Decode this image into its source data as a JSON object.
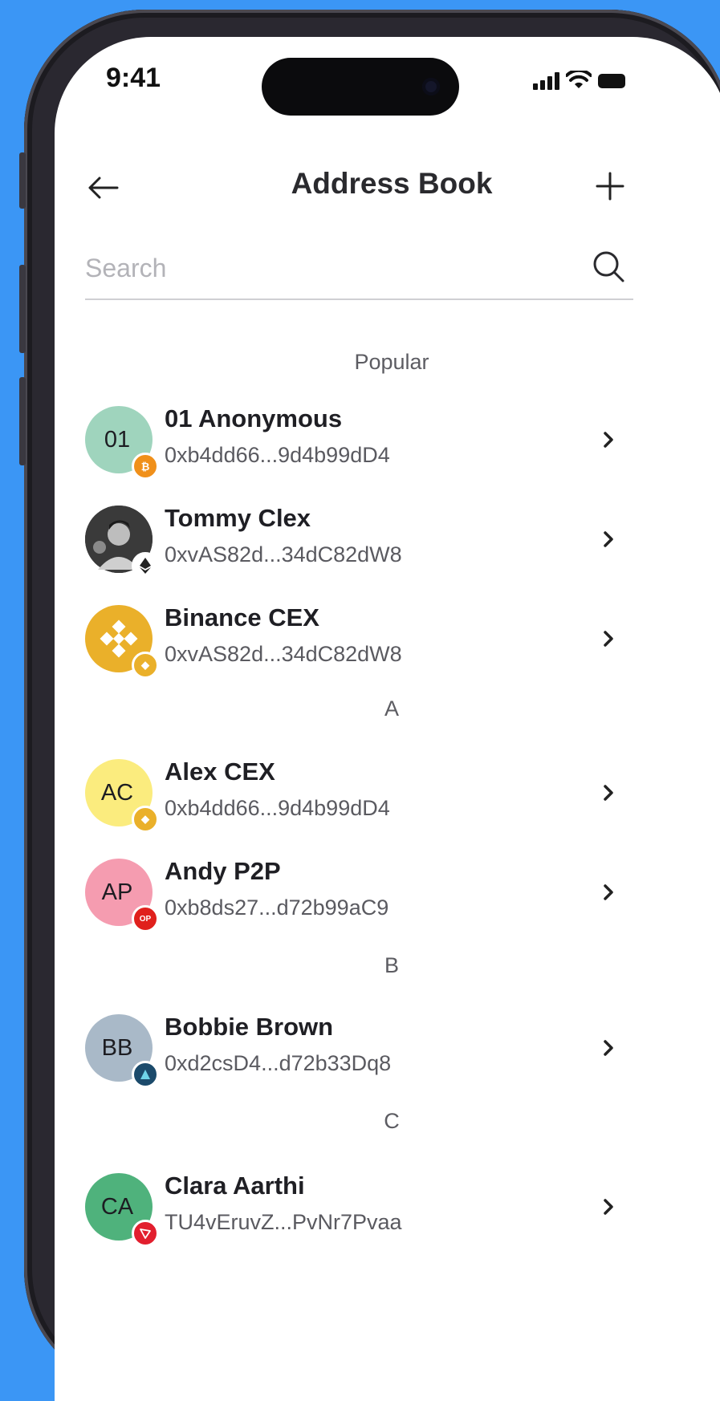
{
  "status_bar": {
    "time": "9:41"
  },
  "header": {
    "title": "Address Book"
  },
  "search": {
    "placeholder": "Search"
  },
  "sections": {
    "popular": "Popular",
    "a": "A",
    "b": "B",
    "c": "C"
  },
  "contacts": {
    "anonymous": {
      "initials": "01",
      "name": "01 Anonymous",
      "address": "0xb4dd66...9d4b99dD4",
      "avatar_color": "#9fd4bd",
      "network_icon": "bitcoin-icon",
      "network_color": "#f0901a"
    },
    "tommy": {
      "initials": "",
      "name": "Tommy Clex",
      "address": "0xvAS82d...34dC82dW8",
      "avatar_color": "#2b2b2b",
      "network_icon": "ethereum-icon",
      "network_color": "#ffffff"
    },
    "binance": {
      "initials": "",
      "name": "Binance CEX",
      "address": "0xvAS82d...34dC82dW8",
      "avatar_color": "#eab02a",
      "network_icon": "bnb-icon",
      "network_color": "#eab02a"
    },
    "alex": {
      "initials": "AC",
      "name": "Alex CEX",
      "address": "0xb4dd66...9d4b99dD4",
      "avatar_color": "#fbec7e",
      "network_icon": "bnb-icon",
      "network_color": "#eab02a"
    },
    "andy": {
      "initials": "AP",
      "name": "Andy P2P",
      "address": "0xb8ds27...d72b99aC9",
      "avatar_color": "#f59cb0",
      "network_icon": "op-icon",
      "network_color": "#e0201c"
    },
    "bobbie": {
      "initials": "BB",
      "name": "Bobbie Brown",
      "address": "0xd2csD4...d72b33Dq8",
      "avatar_color": "#a9b9c8",
      "network_icon": "network-icon",
      "network_color": "#1b4a6b"
    },
    "clara": {
      "initials": "CA",
      "name": "Clara Aarthi",
      "address": "TU4vEruvZ...PvNr7Pvaa",
      "avatar_color": "#4fb27c",
      "network_icon": "tron-icon",
      "network_color": "#e21f2e"
    }
  },
  "colors": {
    "background": "#3b96f5",
    "screen": "#ffffff",
    "text_primary": "#1f1f24",
    "text_secondary": "#5a5a60"
  }
}
